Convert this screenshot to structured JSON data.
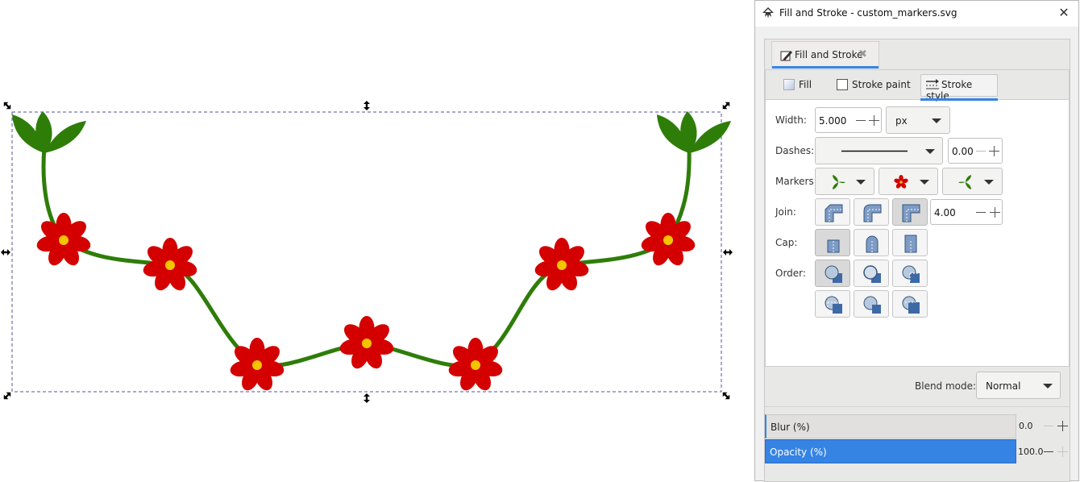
{
  "dialog": {
    "title": "Fill and Stroke - custom_markers.svg",
    "close_glyph": "✕",
    "dock_tab": {
      "label": "Fill and Stroke",
      "close_glyph": "✖"
    },
    "subtabs": [
      {
        "label": "Fill",
        "icon": "fill-swatch-icon",
        "active": false
      },
      {
        "label": "Stroke paint",
        "icon": "stroke-paint-swatch-icon",
        "active": false
      },
      {
        "label": "Stroke style",
        "icon": "stroke-style-icon",
        "active": true
      }
    ],
    "stroke_style": {
      "width_label": "Width:",
      "width_value": "5.000",
      "unit": "px",
      "dashes_label": "Dashes:",
      "dash_offset": "0.00",
      "markers_label": "Markers:",
      "markers": [
        "start-leaf-marker",
        "mid-flower-marker",
        "end-leaf-marker"
      ],
      "join_label": "Join:",
      "join_selected": "miter",
      "miter_limit": "4.00",
      "cap_label": "Cap:",
      "cap_selected": "butt",
      "order_label": "Order:",
      "order_selected": 0
    },
    "blend_mode": {
      "label": "Blend mode:",
      "value": "Normal"
    },
    "blur": {
      "label": "Blur (%)",
      "value": "0.0"
    },
    "opacity": {
      "label": "Opacity (%)",
      "value": "100.0"
    }
  },
  "colors": {
    "accent": "#3584e4",
    "stem": "#2e7d09",
    "petal": "#d40000",
    "flower_center": "#f5c400",
    "selection_dash": "#5050a0"
  }
}
